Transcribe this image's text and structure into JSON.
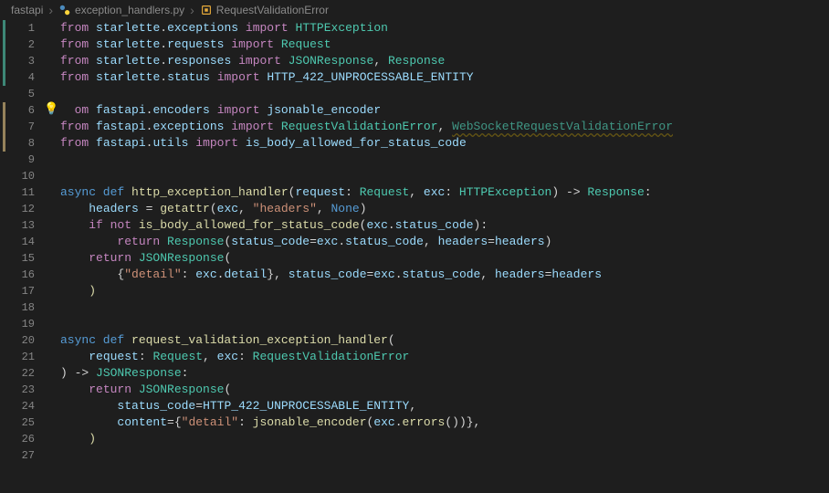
{
  "breadcrumb": {
    "parts": [
      "fastapi",
      "exception_handlers.py",
      "RequestValidationError"
    ]
  },
  "editor": {
    "bulb_line": 6,
    "fold_bars": [
      {
        "start": 1,
        "end": 4,
        "color": "green"
      },
      {
        "start": 6,
        "end": 8,
        "color": "yellow"
      }
    ],
    "lines": [
      {
        "n": 1,
        "segs": [
          [
            "kw-import",
            "from"
          ],
          [
            " "
          ],
          [
            "var",
            "starlette"
          ],
          [
            "punct",
            "."
          ],
          [
            "var",
            "exceptions"
          ],
          [
            " "
          ],
          [
            "kw-import",
            "import"
          ],
          [
            " "
          ],
          [
            "type",
            "HTTPException"
          ]
        ]
      },
      {
        "n": 2,
        "segs": [
          [
            "kw-import",
            "from"
          ],
          [
            " "
          ],
          [
            "var",
            "starlette"
          ],
          [
            "punct",
            "."
          ],
          [
            "var",
            "requests"
          ],
          [
            " "
          ],
          [
            "kw-import",
            "import"
          ],
          [
            " "
          ],
          [
            "type",
            "Request"
          ]
        ]
      },
      {
        "n": 3,
        "segs": [
          [
            "kw-import",
            "from"
          ],
          [
            " "
          ],
          [
            "var",
            "starlette"
          ],
          [
            "punct",
            "."
          ],
          [
            "var",
            "responses"
          ],
          [
            " "
          ],
          [
            "kw-import",
            "import"
          ],
          [
            " "
          ],
          [
            "type",
            "JSONResponse"
          ],
          [
            "punct",
            ", "
          ],
          [
            "type",
            "Response"
          ]
        ]
      },
      {
        "n": 4,
        "segs": [
          [
            "kw-import",
            "from"
          ],
          [
            " "
          ],
          [
            "var",
            "starlette"
          ],
          [
            "punct",
            "."
          ],
          [
            "var",
            "status"
          ],
          [
            " "
          ],
          [
            "kw-import",
            "import"
          ],
          [
            " "
          ],
          [
            "var",
            "HTTP_422_UNPROCESSABLE_ENTITY"
          ]
        ]
      },
      {
        "n": 5,
        "segs": []
      },
      {
        "n": 6,
        "segs": [
          [
            "kw-import",
            "  om"
          ],
          [
            " "
          ],
          [
            "var",
            "fastapi"
          ],
          [
            "punct",
            "."
          ],
          [
            "var",
            "encoders"
          ],
          [
            " "
          ],
          [
            "kw-import",
            "import"
          ],
          [
            " "
          ],
          [
            "var",
            "jsonable_encoder"
          ]
        ]
      },
      {
        "n": 7,
        "segs": [
          [
            "kw-import",
            "from"
          ],
          [
            " "
          ],
          [
            "var",
            "fastapi"
          ],
          [
            "punct",
            "."
          ],
          [
            "var",
            "exceptions"
          ],
          [
            " "
          ],
          [
            "kw-import",
            "import"
          ],
          [
            " "
          ],
          [
            "type",
            "RequestValidationError"
          ],
          [
            "punct",
            ", "
          ],
          [
            "unused",
            "WebSocketRequestValidationError"
          ]
        ]
      },
      {
        "n": 8,
        "segs": [
          [
            "kw-import",
            "from"
          ],
          [
            " "
          ],
          [
            "var",
            "fastapi"
          ],
          [
            "punct",
            "."
          ],
          [
            "var",
            "utils"
          ],
          [
            " "
          ],
          [
            "kw-import",
            "import"
          ],
          [
            " "
          ],
          [
            "var",
            "is_body_allowed_for_status_code"
          ]
        ]
      },
      {
        "n": 9,
        "segs": []
      },
      {
        "n": 10,
        "segs": []
      },
      {
        "n": 11,
        "segs": [
          [
            "kw-def",
            "async def "
          ],
          [
            "func",
            "http_exception_handler"
          ],
          [
            "punct",
            "("
          ],
          [
            "param",
            "request"
          ],
          [
            "punct",
            ": "
          ],
          [
            "type",
            "Request"
          ],
          [
            "punct",
            ", "
          ],
          [
            "param",
            "exc"
          ],
          [
            "punct",
            ": "
          ],
          [
            "type",
            "HTTPException"
          ],
          [
            "punct",
            ") -> "
          ],
          [
            "type",
            "Response"
          ],
          [
            "punct",
            ":"
          ]
        ]
      },
      {
        "n": 12,
        "segs": [
          [
            "punct",
            "    "
          ],
          [
            "var",
            "headers"
          ],
          [
            "punct",
            " = "
          ],
          [
            "func",
            "getattr"
          ],
          [
            "punct",
            "("
          ],
          [
            "var",
            "exc"
          ],
          [
            "punct",
            ", "
          ],
          [
            "str",
            "\"headers\""
          ],
          [
            "punct",
            ", "
          ],
          [
            "kw-const",
            "None"
          ],
          [
            "punct",
            ")"
          ]
        ]
      },
      {
        "n": 13,
        "segs": [
          [
            "punct",
            "    "
          ],
          [
            "kw-control",
            "if not "
          ],
          [
            "func",
            "is_body_allowed_for_status_code"
          ],
          [
            "punct",
            "("
          ],
          [
            "var",
            "exc"
          ],
          [
            "punct",
            "."
          ],
          [
            "attr",
            "status_code"
          ],
          [
            "punct",
            "):"
          ]
        ]
      },
      {
        "n": 14,
        "segs": [
          [
            "punct",
            "        "
          ],
          [
            "kw-control",
            "return "
          ],
          [
            "type",
            "Response"
          ],
          [
            "punct",
            "("
          ],
          [
            "param",
            "status_code"
          ],
          [
            "punct",
            "="
          ],
          [
            "var",
            "exc"
          ],
          [
            "punct",
            "."
          ],
          [
            "attr",
            "status_code"
          ],
          [
            "punct",
            ", "
          ],
          [
            "param",
            "headers"
          ],
          [
            "punct",
            "="
          ],
          [
            "var",
            "headers"
          ],
          [
            "punct",
            ")"
          ]
        ]
      },
      {
        "n": 15,
        "segs": [
          [
            "punct",
            "    "
          ],
          [
            "kw-control",
            "return "
          ],
          [
            "type",
            "JSONResponse"
          ],
          [
            "punct",
            "("
          ]
        ]
      },
      {
        "n": 16,
        "segs": [
          [
            "punct",
            "        {"
          ],
          [
            "str",
            "\"detail\""
          ],
          [
            "punct",
            ": "
          ],
          [
            "var",
            "exc"
          ],
          [
            "punct",
            "."
          ],
          [
            "attr",
            "detail"
          ],
          [
            "punct",
            "}, "
          ],
          [
            "param",
            "status_code"
          ],
          [
            "punct",
            "="
          ],
          [
            "var",
            "exc"
          ],
          [
            "punct",
            "."
          ],
          [
            "attr",
            "status_code"
          ],
          [
            "punct",
            ", "
          ],
          [
            "param",
            "headers"
          ],
          [
            "punct",
            "="
          ],
          [
            "var",
            "headers"
          ]
        ]
      },
      {
        "n": 17,
        "segs": [
          [
            "punct",
            "    "
          ],
          [
            "func",
            ")"
          ]
        ]
      },
      {
        "n": 18,
        "segs": []
      },
      {
        "n": 19,
        "segs": []
      },
      {
        "n": 20,
        "segs": [
          [
            "kw-def",
            "async def "
          ],
          [
            "func",
            "request_validation_exception_handler"
          ],
          [
            "punct",
            "("
          ]
        ]
      },
      {
        "n": 21,
        "segs": [
          [
            "punct",
            "    "
          ],
          [
            "param",
            "request"
          ],
          [
            "punct",
            ": "
          ],
          [
            "type",
            "Request"
          ],
          [
            "punct",
            ", "
          ],
          [
            "param",
            "exc"
          ],
          [
            "punct",
            ": "
          ],
          [
            "type",
            "RequestValidationError"
          ]
        ]
      },
      {
        "n": 22,
        "segs": [
          [
            "punct",
            ") -> "
          ],
          [
            "type",
            "JSONResponse"
          ],
          [
            "punct",
            ":"
          ]
        ]
      },
      {
        "n": 23,
        "segs": [
          [
            "punct",
            "    "
          ],
          [
            "kw-control",
            "return "
          ],
          [
            "type",
            "JSONResponse"
          ],
          [
            "punct",
            "("
          ]
        ]
      },
      {
        "n": 24,
        "segs": [
          [
            "punct",
            "        "
          ],
          [
            "param",
            "status_code"
          ],
          [
            "punct",
            "="
          ],
          [
            "var",
            "HTTP_422_UNPROCESSABLE_ENTITY"
          ],
          [
            "punct",
            ","
          ]
        ]
      },
      {
        "n": 25,
        "segs": [
          [
            "punct",
            "        "
          ],
          [
            "param",
            "content"
          ],
          [
            "punct",
            "={"
          ],
          [
            "str",
            "\"detail\""
          ],
          [
            "punct",
            ": "
          ],
          [
            "func",
            "jsonable_encoder"
          ],
          [
            "punct",
            "("
          ],
          [
            "var",
            "exc"
          ],
          [
            "punct",
            "."
          ],
          [
            "func",
            "errors"
          ],
          [
            "punct",
            "())},"
          ]
        ]
      },
      {
        "n": 26,
        "segs": [
          [
            "punct",
            "    "
          ],
          [
            "func",
            ")"
          ]
        ]
      },
      {
        "n": 27,
        "segs": []
      }
    ]
  }
}
